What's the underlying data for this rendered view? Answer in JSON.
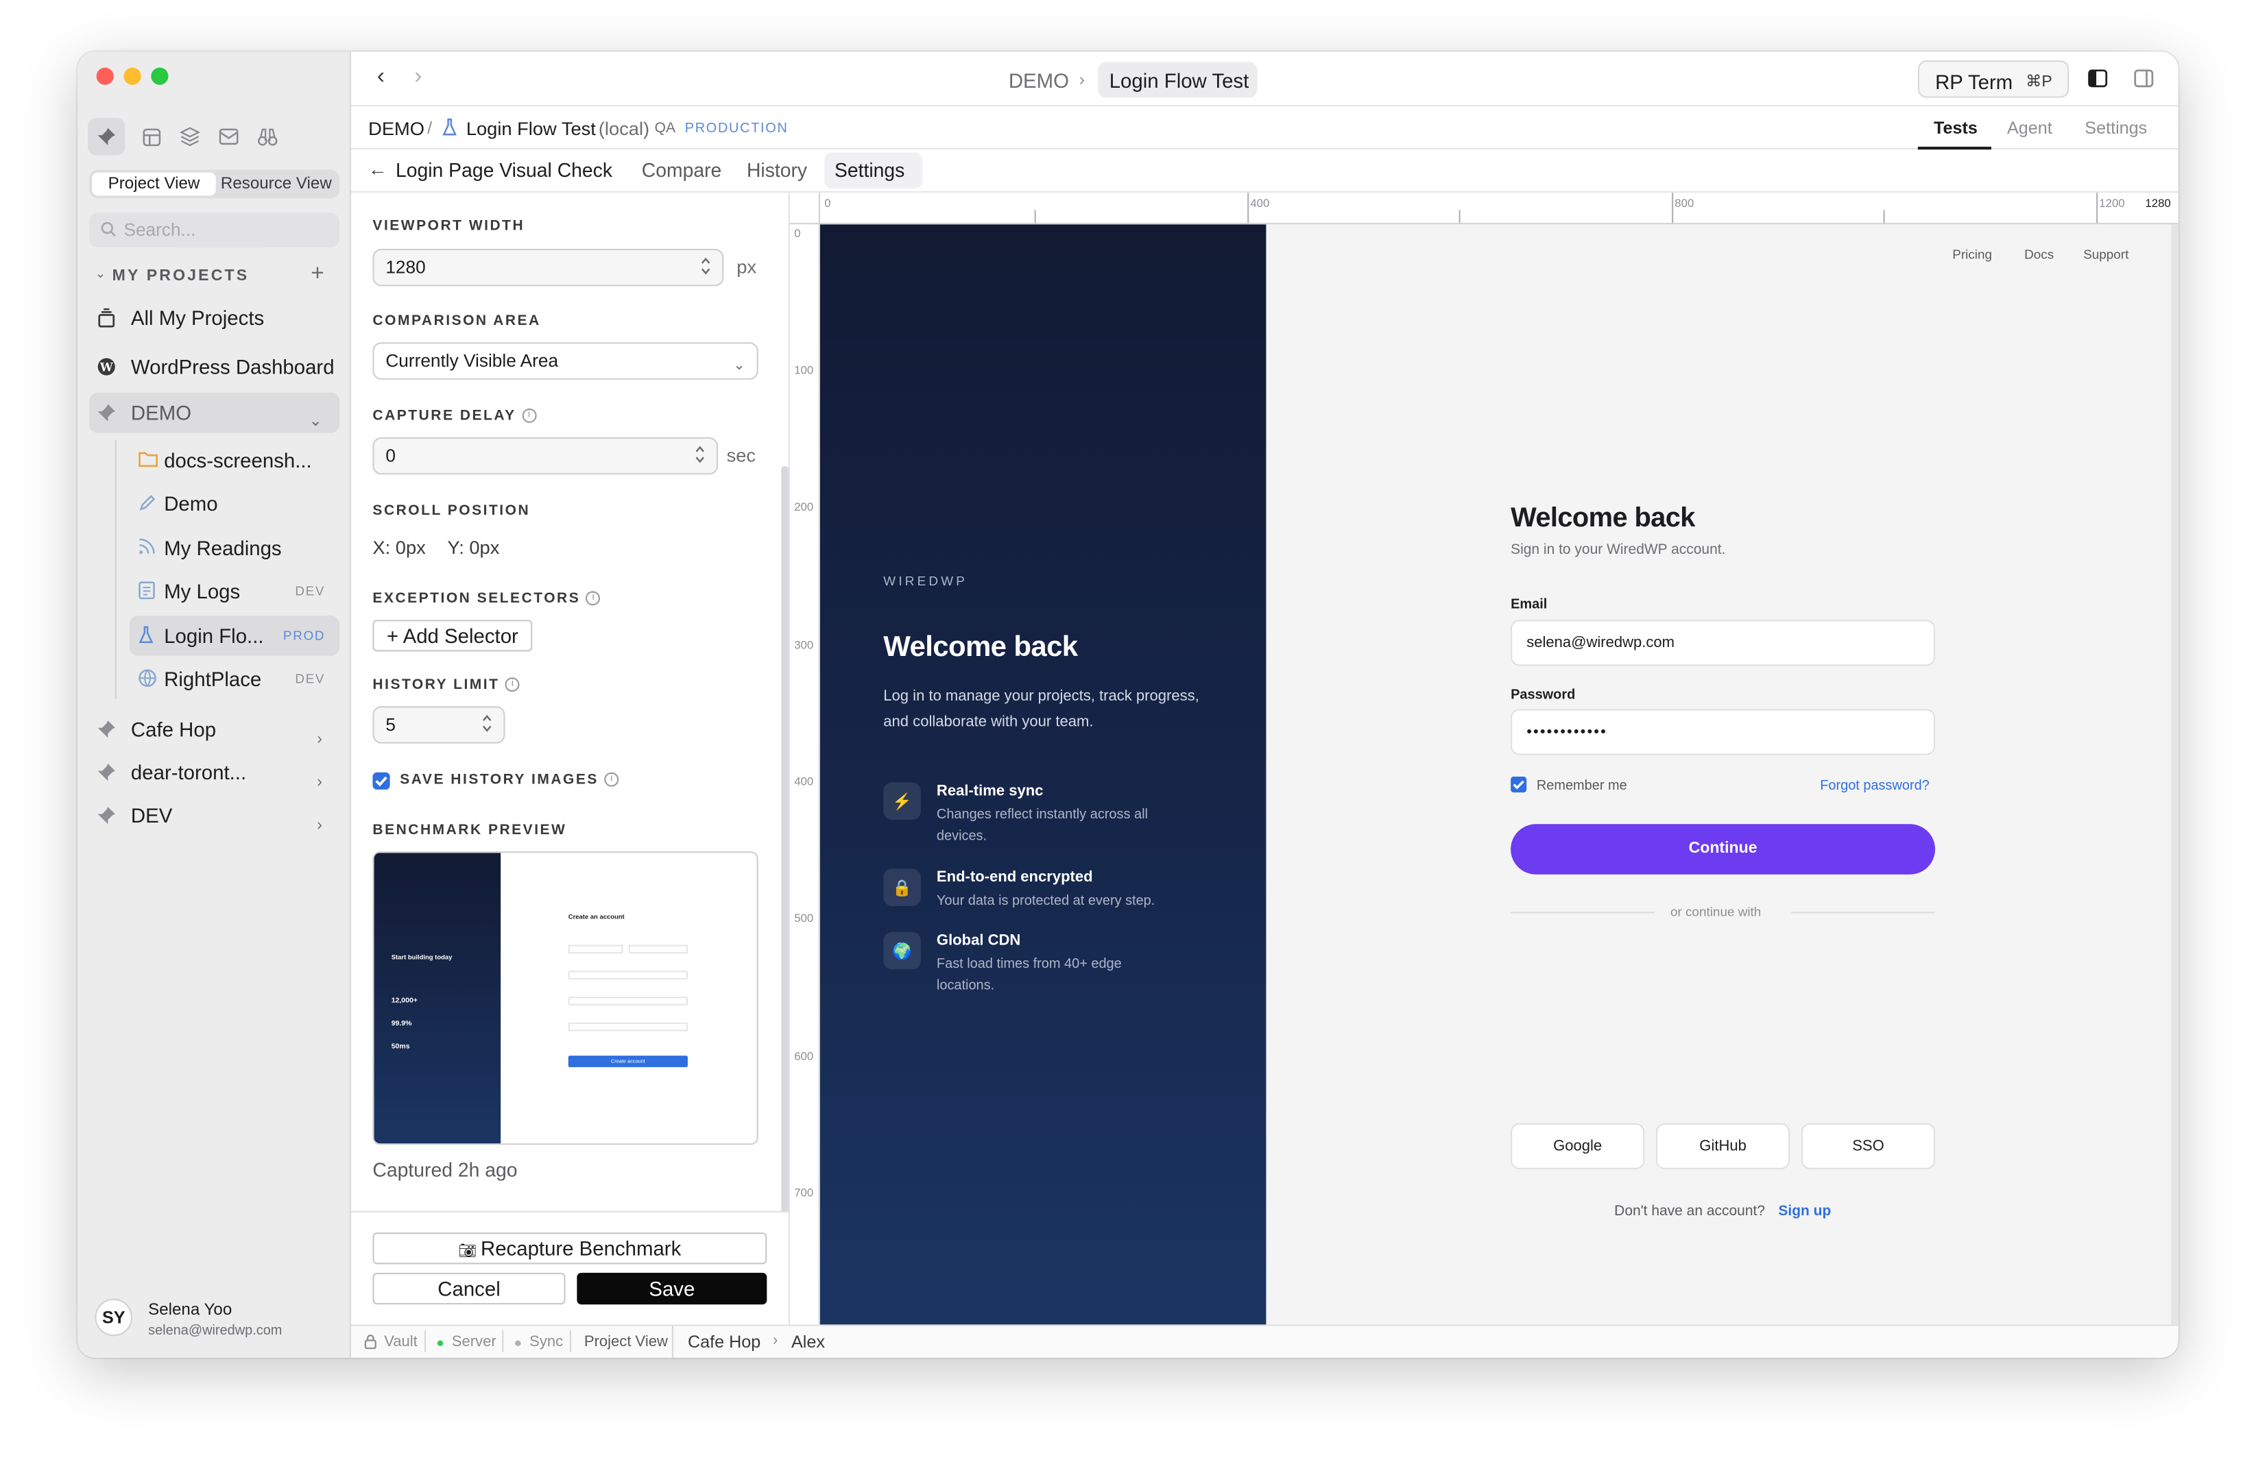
{
  "window": {
    "traffic_lights": {
      "close": "#ff5f57",
      "minimize": "#febc2e",
      "zoom": "#28c840"
    }
  },
  "sidebar": {
    "toolbar_icons": [
      "pin-icon",
      "table-icon",
      "layers-icon",
      "mail-icon",
      "binoculars-icon"
    ],
    "view_toggle": {
      "project": "Project View",
      "resource": "Resource View"
    },
    "search_placeholder": "Search...",
    "section_title": "MY PROJECTS",
    "items": {
      "all_projects": "All My Projects",
      "wordpress": "WordPress Dashboard",
      "demo": "DEMO",
      "cafe_hop": "Cafe Hop",
      "dear_toronto": "dear-toront...",
      "dev": "DEV"
    },
    "demo_children": [
      {
        "label": "docs-screensh...",
        "tag": "",
        "icon": "folder-icon"
      },
      {
        "label": "Demo",
        "tag": "",
        "icon": "pen-icon"
      },
      {
        "label": "My Readings",
        "tag": "",
        "icon": "rss-icon"
      },
      {
        "label": "My Logs",
        "tag": "DEV",
        "icon": "log-icon"
      },
      {
        "label": "Login Flo...",
        "tag": "PROD",
        "icon": "flask-icon"
      },
      {
        "label": "RightPlace",
        "tag": "DEV",
        "icon": "globe-icon"
      }
    ],
    "user": {
      "initials": "SY",
      "name": "Selena Yoo",
      "email": "selena@wiredwp.com"
    }
  },
  "topbar": {
    "crumb_project": "DEMO",
    "crumb_separator": "›",
    "active_tab": "Login Flow Test",
    "terminal_label": "RP Term",
    "terminal_shortcut": "⌘P"
  },
  "crumb": {
    "project": "DEMO",
    "sep": "/",
    "test": "Login Flow Test",
    "test_suffix": "(local)",
    "env_label": "QA",
    "env_value": "PRODUCTION",
    "right_tabs": [
      "Tests",
      "Agent",
      "Settings"
    ]
  },
  "subtabs": {
    "title": "Login Page Visual Check",
    "tabs": [
      "Compare",
      "History",
      "Settings"
    ]
  },
  "settings": {
    "viewport_label": "VIEWPORT WIDTH",
    "viewport_value": "1280",
    "viewport_unit": "px",
    "area_label": "COMPARISON AREA",
    "area_value": "Currently Visible Area",
    "delay_label": "CAPTURE DELAY",
    "delay_value": "0",
    "delay_unit": "sec",
    "scroll_label": "SCROLL POSITION",
    "scroll_x": "X: 0px",
    "scroll_y": "Y: 0px",
    "exception_label": "EXCEPTION SELECTORS",
    "add_selector": "+ Add Selector",
    "history_label": "HISTORY LIMIT",
    "history_value": "5",
    "save_history_label": "SAVE HISTORY IMAGES",
    "save_history_checked": true,
    "benchmark_label": "BENCHMARK PREVIEW",
    "captured": "Captured 2h ago",
    "recapture": "Recapture Benchmark",
    "cancel": "Cancel",
    "save": "Save"
  },
  "benchmark_thumb": {
    "heading": "Create an account",
    "left_title": "Start building today",
    "stats": [
      "12,000+",
      "99.9%",
      "50ms"
    ],
    "button": "Create account"
  },
  "ruler": {
    "top": [
      "0",
      "400",
      "800",
      "1200",
      "1280"
    ],
    "left": [
      "0",
      "100",
      "200",
      "300",
      "400",
      "500",
      "600",
      "700"
    ]
  },
  "page": {
    "brand": "WIREDWP",
    "hero_title": "Welcome back",
    "hero_desc": "Log in to manage your projects, track progress, and collaborate with your team.",
    "features": [
      {
        "title": "Real-time sync",
        "desc": "Changes reflect instantly across all devices.",
        "icon": "⚡"
      },
      {
        "title": "End-to-end encrypted",
        "desc": "Your data is protected at every step.",
        "icon": "🔒"
      },
      {
        "title": "Global CDN",
        "desc": "Fast load times from 40+ edge locations.",
        "icon": "🌍"
      }
    ],
    "nav": [
      "Pricing",
      "Docs",
      "Support"
    ],
    "form_title": "Welcome back",
    "form_subtitle": "Sign in to your WiredWP account.",
    "email_label": "Email",
    "email_value": "selena@wiredwp.com",
    "password_label": "Password",
    "password_value": "••••••••••••",
    "remember": "Remember me",
    "forgot": "Forgot password?",
    "continue": "Continue",
    "divider": "or continue with",
    "social": [
      "Google",
      "GitHub",
      "SSO"
    ],
    "signup_prompt": "Don't have an account?",
    "signup_link": "Sign up",
    "accent": "#6d3bf0"
  },
  "statusbar": {
    "vault": "Vault",
    "server": "Server",
    "sync": "Sync",
    "view": "Project View",
    "path1": "Cafe Hop",
    "path_sep": "›",
    "path2": "Alex"
  }
}
